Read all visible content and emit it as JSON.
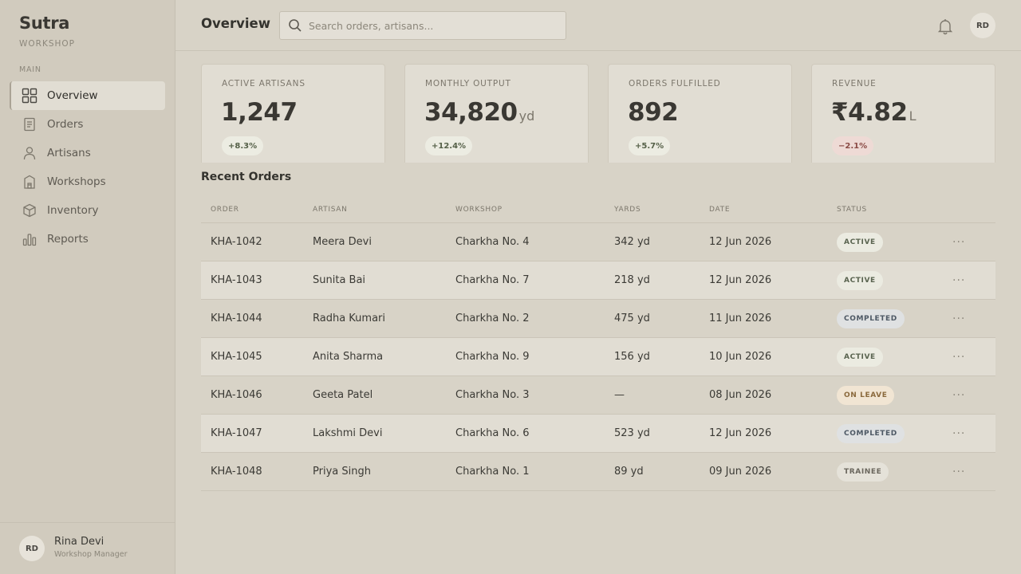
{
  "app": {
    "brand": "Sutra",
    "brand_sub": "WORKSHOP"
  },
  "sidebar": {
    "section_label": "MAIN",
    "items": [
      {
        "label": "Overview",
        "icon": "grid-icon",
        "active": true
      },
      {
        "label": "Orders",
        "icon": "document-icon"
      },
      {
        "label": "Artisans",
        "icon": "user-icon"
      },
      {
        "label": "Workshops",
        "icon": "building-icon"
      },
      {
        "label": "Inventory",
        "icon": "box-icon"
      },
      {
        "label": "Reports",
        "icon": "bar-chart-icon"
      }
    ],
    "user": {
      "initials": "RD",
      "name": "Rina Devi",
      "role": "Workshop Manager"
    }
  },
  "header": {
    "title": "Overview",
    "search_placeholder": "Search orders, artisans...",
    "avatar_initials": "RD"
  },
  "kpis": [
    {
      "label": "ACTIVE ARTISANS",
      "value": "1,247",
      "unit": "",
      "change": "+8.3%",
      "trend": "up"
    },
    {
      "label": "MONTHLY OUTPUT",
      "value": "34,820",
      "unit": "yd",
      "change": "+12.4%",
      "trend": "up"
    },
    {
      "label": "ORDERS FULFILLED",
      "value": "892",
      "unit": "",
      "change": "+5.7%",
      "trend": "up"
    },
    {
      "label": "REVENUE",
      "value": "₹4.82",
      "unit": "L",
      "change": "−2.1%",
      "trend": "down"
    }
  ],
  "orders": {
    "title": "Recent Orders",
    "columns": [
      "ORDER",
      "ARTISAN",
      "WORKSHOP",
      "YARDS",
      "DATE",
      "STATUS"
    ],
    "rows": [
      {
        "order": "KHA-1042",
        "artisan": "Meera Devi",
        "workshop": "Charkha No. 4",
        "yards": "342 yd",
        "date": "12 Jun 2026",
        "status": "ACTIVE",
        "status_type": "active"
      },
      {
        "order": "KHA-1043",
        "artisan": "Sunita Bai",
        "workshop": "Charkha No. 7",
        "yards": "218 yd",
        "date": "12 Jun 2026",
        "status": "ACTIVE",
        "status_type": "active"
      },
      {
        "order": "KHA-1044",
        "artisan": "Radha Kumari",
        "workshop": "Charkha No. 2",
        "yards": "475 yd",
        "date": "11 Jun 2026",
        "status": "COMPLETED",
        "status_type": "completed"
      },
      {
        "order": "KHA-1045",
        "artisan": "Anita Sharma",
        "workshop": "Charkha No. 9",
        "yards": "156 yd",
        "date": "10 Jun 2026",
        "status": "ACTIVE",
        "status_type": "active"
      },
      {
        "order": "KHA-1046",
        "artisan": "Geeta Patel",
        "workshop": "Charkha No. 3",
        "yards": "—",
        "date": "08 Jun 2026",
        "status": "ON LEAVE",
        "status_type": "onleave"
      },
      {
        "order": "KHA-1047",
        "artisan": "Lakshmi Devi",
        "workshop": "Charkha No. 6",
        "yards": "523 yd",
        "date": "12 Jun 2026",
        "status": "COMPLETED",
        "status_type": "completed"
      },
      {
        "order": "KHA-1048",
        "artisan": "Priya Singh",
        "workshop": "Charkha No. 1",
        "yards": "89 yd",
        "date": "09 Jun 2026",
        "status": "TRAINEE",
        "status_type": "trainee"
      }
    ],
    "more_label": "···"
  }
}
